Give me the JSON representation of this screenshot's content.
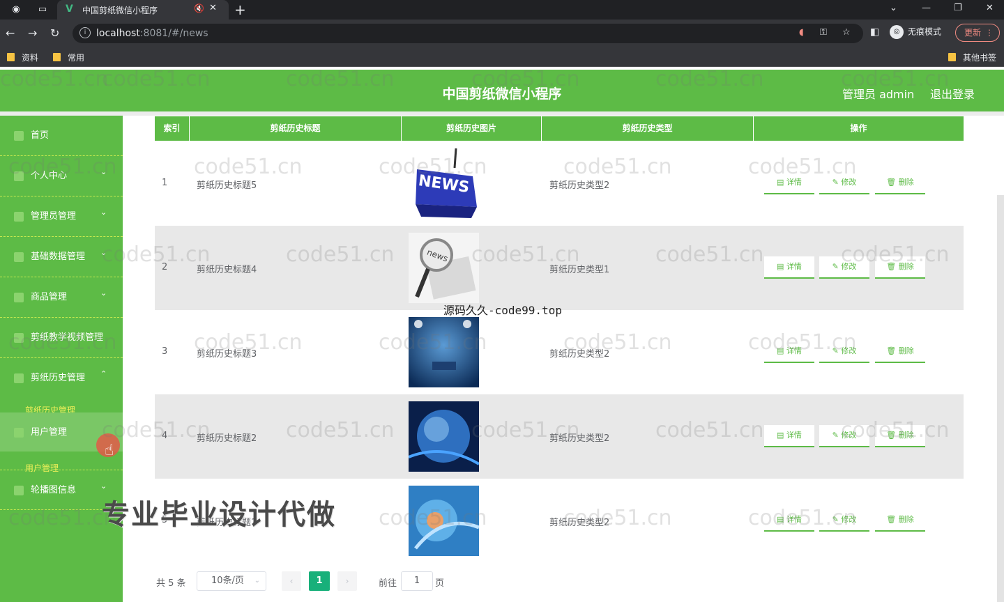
{
  "browser": {
    "tab_title": "中国剪纸微信小程序",
    "url_host": "localhost",
    "url_path": ":8081/#/news",
    "profile_label": "无痕模式",
    "update_label": "更新",
    "bookmarks": [
      "资料",
      "常用"
    ],
    "other_bookmarks": "其他书签"
  },
  "header": {
    "title": "中国剪纸微信小程序",
    "admin_label": "管理员 admin",
    "logout_label": "退出登录"
  },
  "sidebar": {
    "items": [
      {
        "label": "首页"
      },
      {
        "label": "个人中心"
      },
      {
        "label": "管理员管理"
      },
      {
        "label": "基础数据管理"
      },
      {
        "label": "商品管理"
      },
      {
        "label": "剪纸教学视频管理"
      },
      {
        "label": "剪纸历史管理"
      },
      {
        "label": "用户管理"
      },
      {
        "label": "轮播图信息"
      }
    ],
    "submenus": [
      "剪纸历史管理",
      "用户管理"
    ]
  },
  "table": {
    "headers": [
      "索引",
      "剪纸历史标题",
      "剪纸历史图片",
      "剪纸历史类型",
      "操作"
    ],
    "rows": [
      {
        "index": "1",
        "title": "剪纸历史标题5",
        "type": "剪纸历史类型2"
      },
      {
        "index": "2",
        "title": "剪纸历史标题4",
        "type": "剪纸历史类型1"
      },
      {
        "index": "3",
        "title": "剪纸历史标题3",
        "type": "剪纸历史类型2"
      },
      {
        "index": "4",
        "title": "剪纸历史标题2",
        "type": "剪纸历史类型2"
      },
      {
        "index": "5",
        "title": "剪纸历史标题1",
        "type": "剪纸历史类型2"
      }
    ],
    "actions": {
      "detail": "详情",
      "edit": "修改",
      "delete": "删除"
    }
  },
  "pagination": {
    "total": "共 5 条",
    "page_size": "10条/页",
    "current_page": "1",
    "goto_label": "前往",
    "goto_value": "1",
    "page_unit": "页"
  },
  "overlays": {
    "code_text": "源码久久-code99.top",
    "ad_text": "专业毕业设计代做",
    "watermark": "code51.cn"
  },
  "colors": {
    "primary": "#5dbb46",
    "pager_active": "#18b07a"
  }
}
